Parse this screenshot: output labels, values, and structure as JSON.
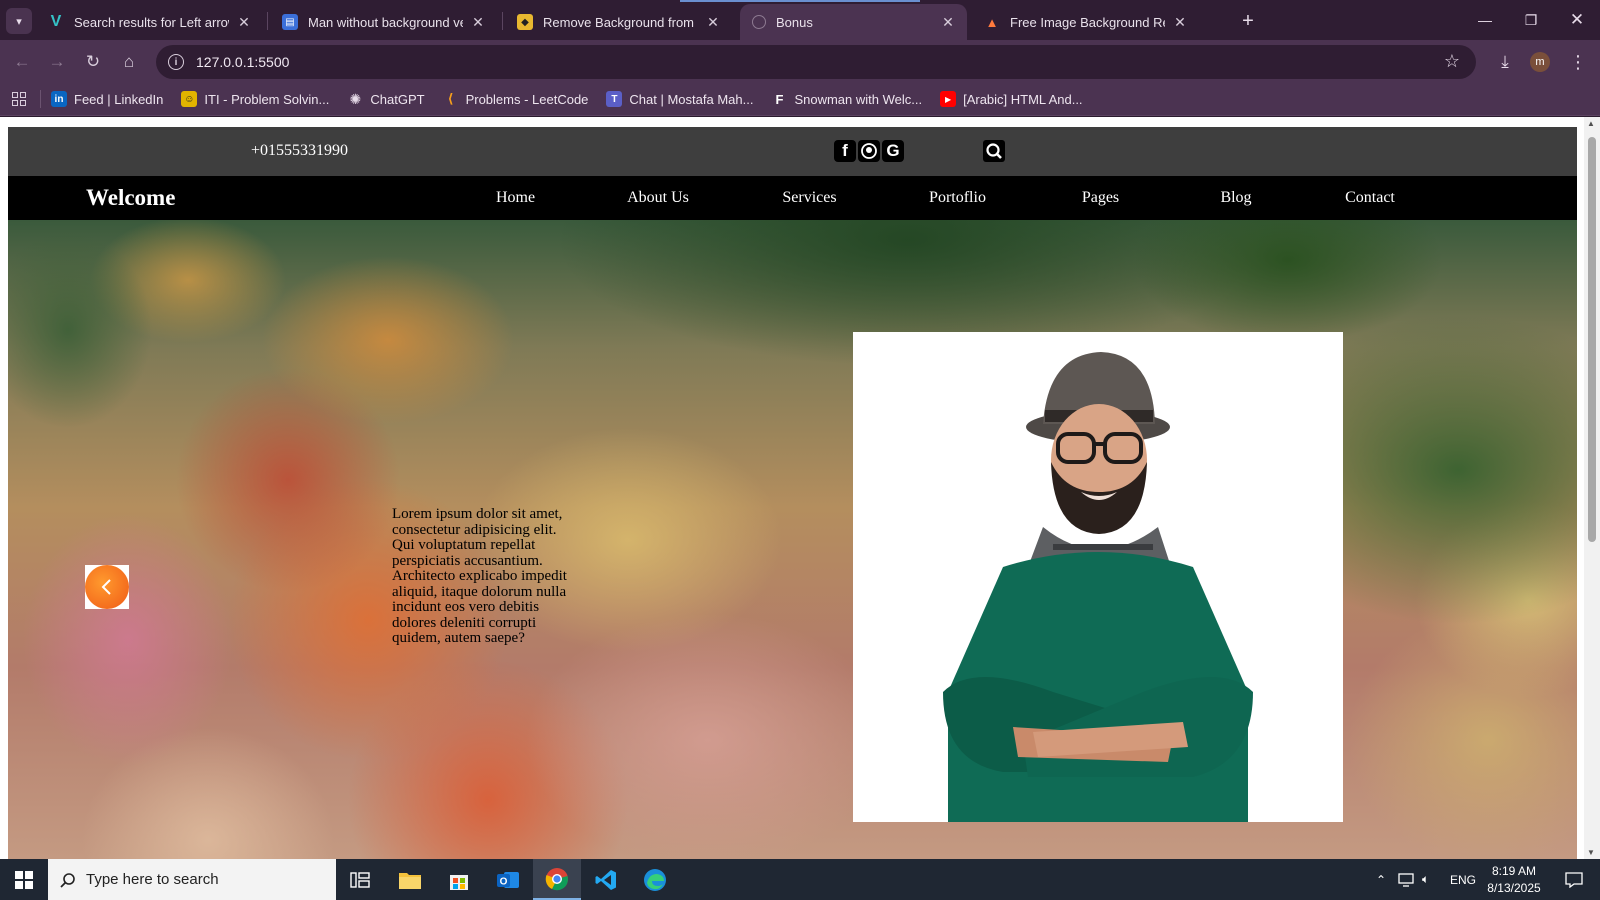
{
  "browser": {
    "tabs": [
      {
        "title": "Search results for Left arrow bu",
        "favicon": "vectors-v-icon",
        "active": false
      },
      {
        "title": "Man without background vecto",
        "favicon": "document-icon",
        "active": false
      },
      {
        "title": "Remove Background from Imag",
        "favicon": "image-icon",
        "active": false
      },
      {
        "title": "Bonus",
        "favicon": "globe-icon",
        "active": true
      },
      {
        "title": "Free Image Background Remov",
        "favicon": "triangle-logo-icon",
        "active": false
      }
    ],
    "url": "127.0.0.1:5500",
    "profile_initial": "m",
    "bookmarks": [
      {
        "label": "Feed | LinkedIn",
        "icon": "linkedin-icon",
        "color": "#0a66c2"
      },
      {
        "label": "ITI - Problem Solvin...",
        "icon": "smiley-icon",
        "color": "#e2b400"
      },
      {
        "label": "ChatGPT",
        "icon": "chatgpt-icon",
        "color": "#444444"
      },
      {
        "label": "Problems - LeetCode",
        "icon": "leetcode-icon",
        "color": "#f89f1b"
      },
      {
        "label": "Chat | Mostafa Mah...",
        "icon": "teams-icon",
        "color": "#5b5fc7"
      },
      {
        "label": "Snowman with Welc...",
        "icon": "freepik-icon",
        "color": "#111111"
      },
      {
        "label": "[Arabic] HTML And...",
        "icon": "youtube-icon",
        "color": "#ff0000"
      }
    ]
  },
  "site": {
    "phone": "+01555331990",
    "brand": "Welcome",
    "nav": [
      "Home",
      "About Us",
      "Services",
      "Portoflio",
      "Pages",
      "Blog",
      "Contact"
    ],
    "hero_text": "Lorem ipsum dolor sit amet, consectetur adipisicing elit. Qui voluptatum repellat perspiciatis accusantium. Architecto explicabo impedit aliquid, itaque dolorum nulla incidunt eos vero debitis dolores deleniti corrupti quidem, autem saepe?",
    "accent": "#f26a1b"
  },
  "taskbar": {
    "search_placeholder": "Type here to search",
    "language": "ENG",
    "time": "8:19 AM",
    "date": "8/13/2025"
  }
}
